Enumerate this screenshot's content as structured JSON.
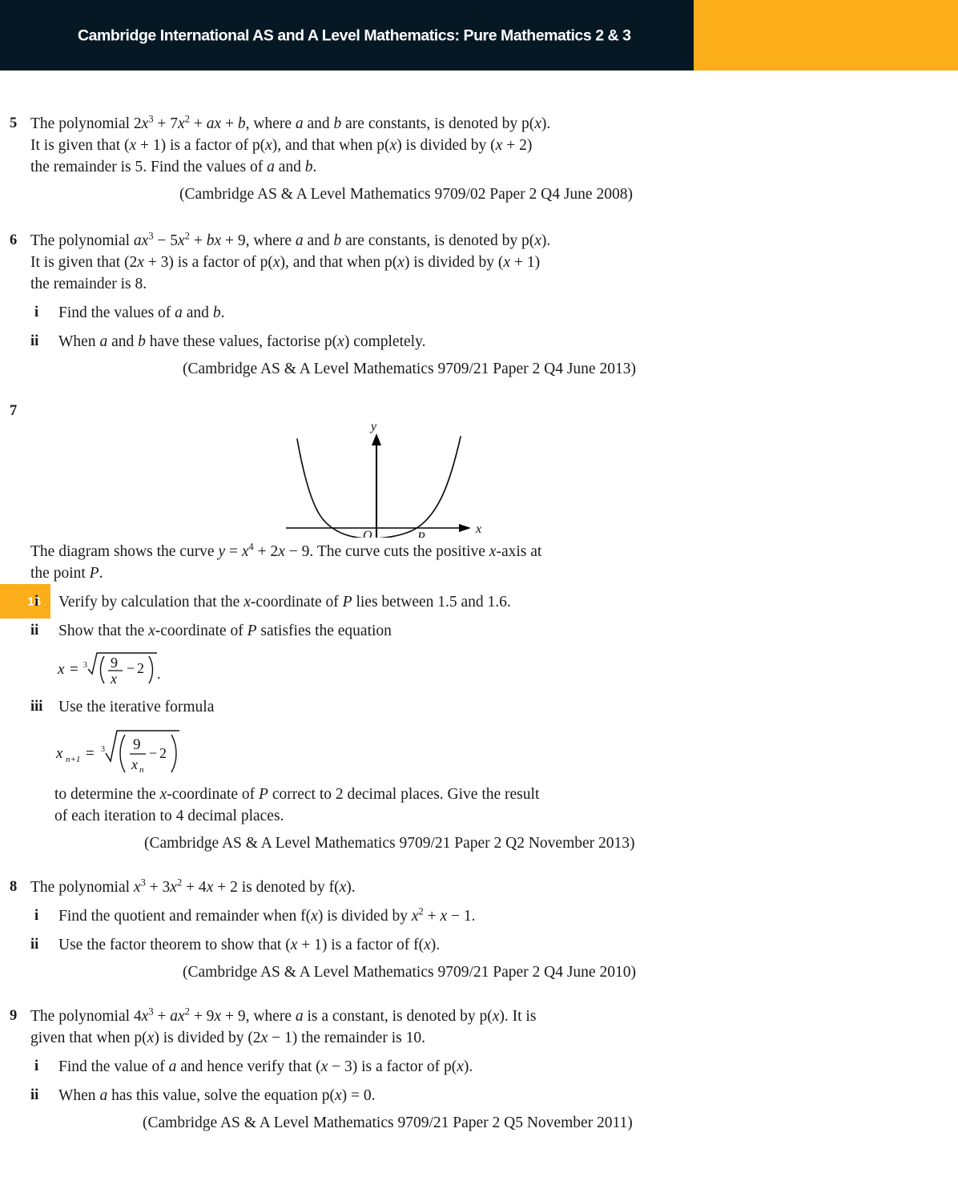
{
  "header": {
    "title": "Cambridge International AS and A Level Mathematics: Pure Mathematics 2 & 3",
    "navy_color": "#061824",
    "orange_color": "#FBAE1A"
  },
  "page_tab": {
    "number": "16",
    "color": "#FBAE1A"
  },
  "questions": [
    {
      "number": "5",
      "lines": [
        "The polynomial 2x³ + 7x² + ax + b, where a and b are constants, is denoted by p(x).",
        "It is given that (x + 1) is a factor of p(x), and that when p(x) is divided by (x + 2)",
        "the remainder is 5. Find the values of a and b."
      ],
      "citation": "(Cambridge AS & A Level Mathematics 9709/02 Paper 2 Q4 June 2008)"
    },
    {
      "number": "6",
      "lines": [
        "The polynomial ax³ − 5x² + bx + 9, where a and b are constants, is denoted by p(x).",
        "It is given that (2x + 3) is a factor of p(x), and that when p(x) is divided by (x + 1)",
        "the remainder is 8."
      ],
      "parts": [
        {
          "label": "i",
          "text": "Find the values of a and b."
        },
        {
          "label": "ii",
          "text": "When a and b have these values, factorise p(x) completely."
        }
      ],
      "citation": "(Cambridge AS & A Level Mathematics 9709/21 Paper 2 Q4 June 2013)"
    },
    {
      "number": "7",
      "lines": [
        "The diagram shows the curve y = x⁴ + 2x − 9. The curve cuts the positive x-axis at",
        "the point P."
      ],
      "parts": [
        {
          "label": "i",
          "text": "Verify by calculation that the x-coordinate of P lies between 1.5 and 1.6."
        },
        {
          "label": "ii",
          "text": "Show that the x-coordinate of P satisfies the equation"
        },
        {
          "label": "iii",
          "text": "Use the iterative formula"
        }
      ],
      "tail_lines": [
        "to determine the x-coordinate of P correct to 2 decimal places. Give the result",
        "of each iteration to 4 decimal places."
      ],
      "citation": "(Cambridge AS & A Level Mathematics 9709/21 Paper 2 Q2 November 2013)"
    },
    {
      "number": "8",
      "lines": [
        "The polynomial x³ + 3x² + 4x + 2 is denoted by f(x)."
      ],
      "parts": [
        {
          "label": "i",
          "text": "Find the quotient and remainder when f(x) is divided by x² + x − 1."
        },
        {
          "label": "ii",
          "text": "Use the factor theorem to show that (x + 1) is a factor of f(x)."
        }
      ],
      "citation": "(Cambridge AS & A Level Mathematics 9709/21 Paper 2 Q4 June 2010)"
    },
    {
      "number": "9",
      "lines": [
        "The polynomial 4x³ + ax² + 9x + 9, where a is a constant, is denoted by p(x). It is",
        "given that when p(x) is divided by (2x − 1) the remainder is 10."
      ],
      "parts": [
        {
          "label": "i",
          "text": "Find the value of a and hence verify that (x − 3) is a factor of p(x)."
        },
        {
          "label": "ii",
          "text": "When a has this value, solve the equation p(x) = 0."
        }
      ],
      "citation": "(Cambridge AS & A Level Mathematics 9709/21 Paper 2 Q5 November 2011)"
    }
  ],
  "figure": {
    "curve_equation": "y = x⁴ + 2x − 9",
    "axis_labels": {
      "x": "x",
      "y": "y"
    },
    "point_labels": {
      "origin": "O",
      "root": "P"
    }
  },
  "formulas": {
    "eq1": {
      "lhs": "x",
      "equals": "=",
      "index": "3",
      "numerator": "9",
      "denominator": "x",
      "minus": "−",
      "constant": "2",
      "terminator": "."
    },
    "eq2": {
      "lhs_base": "x",
      "lhs_sub": "n+1",
      "equals": "=",
      "index": "3",
      "numerator": "9",
      "denominator_base": "x",
      "denominator_sub": "n",
      "minus": "−",
      "constant": "2"
    }
  }
}
